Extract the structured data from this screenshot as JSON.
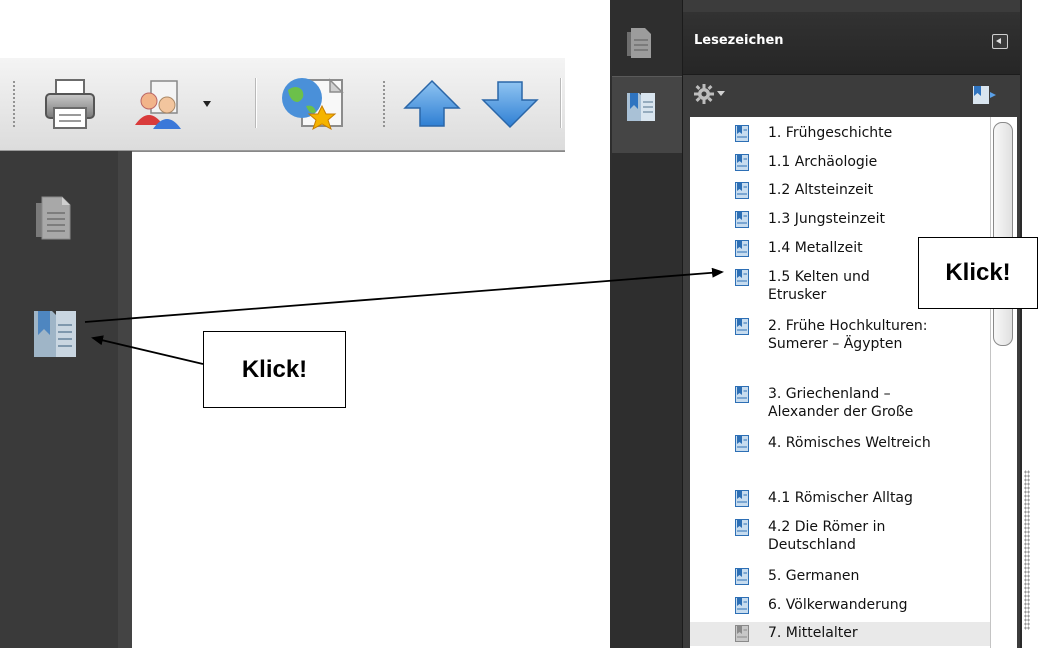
{
  "panel": {
    "title": "Lesezeichen"
  },
  "bookmarks": [
    {
      "label": "1. Frühgeschichte",
      "selected": false
    },
    {
      "label": "1.1 Archäologie",
      "selected": false
    },
    {
      "label": "1.2 Altsteinzeit",
      "selected": false
    },
    {
      "label": "1.3 Jungsteinzeit",
      "selected": false
    },
    {
      "label": "1.4 Metallzeit",
      "selected": false
    },
    {
      "label": "1.5 Kelten und\nEtrusker",
      "selected": false
    },
    {
      "label": "2. Frühe Hochkulturen:\nSumerer – Ägypten",
      "selected": false
    },
    {
      "label": "3. Griechenland –\nAlexander der Große",
      "selected": false
    },
    {
      "label": "4. Römisches Weltreich",
      "selected": false
    },
    {
      "label": "4.1 Römischer Alltag",
      "selected": false
    },
    {
      "label": "4.2 Die Römer in\nDeutschland",
      "selected": false
    },
    {
      "label": "5. Germanen",
      "selected": false
    },
    {
      "label": "6. Völkerwanderung",
      "selected": false
    },
    {
      "label": "7. Mittelalter",
      "selected": true
    }
  ],
  "callouts": {
    "left": "Klick!",
    "right": "Klick!"
  },
  "icons": {
    "toolbar": [
      "printer-icon",
      "share-users-icon",
      "web-capture-icon",
      "arrow-up-icon",
      "arrow-down-icon"
    ],
    "nav": [
      "pages-icon",
      "bookmarks-icon"
    ],
    "panel": [
      "options-gear-icon",
      "new-bookmark-icon",
      "collapse-panel-icon"
    ]
  },
  "colors": {
    "panel_dark": "#3c3c3c",
    "bookmark_icon": "#2d6fb5",
    "arrow_blue": "#3d8fdc"
  }
}
